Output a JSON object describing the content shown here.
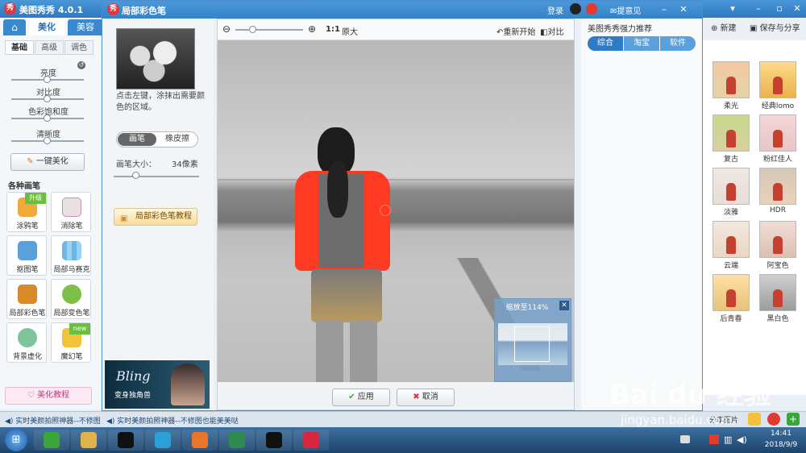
{
  "outer": {
    "title": "美图秀秀 4.0.1",
    "login": "登录",
    "feedback": "提意见",
    "new_label": "新建",
    "save_label": "保存与分享",
    "share_label": "分享图片"
  },
  "left_panel": {
    "tabs": [
      "美化",
      "美容"
    ],
    "home_icon": "home-icon",
    "sub_tabs": [
      "基础",
      "高级",
      "调色"
    ],
    "sliders": [
      {
        "label": "亮度",
        "value": 0.5
      },
      {
        "label": "对比度",
        "value": 0.5
      },
      {
        "label": "色彩饱和度",
        "value": 0.5
      },
      {
        "label": "清晰度",
        "value": 0.5
      }
    ],
    "one_click": "一键美化",
    "brush_section": "各种画笔",
    "tools": [
      {
        "label": "涂鸦笔",
        "ribbon": "升级"
      },
      {
        "label": "消除笔",
        "ribbon": ""
      },
      {
        "label": "抠图笔",
        "ribbon": ""
      },
      {
        "label": "局部马赛克",
        "ribbon": ""
      },
      {
        "label": "局部彩色笔",
        "ribbon": ""
      },
      {
        "label": "局部变色笔",
        "ribbon": ""
      },
      {
        "label": "背景虚化",
        "ribbon": ""
      },
      {
        "label": "魔幻笔",
        "ribbon": "new"
      }
    ],
    "tutorial": "美化教程"
  },
  "dialog": {
    "title": "局部彩色笔",
    "hint": "点击左键，涂抹出需要颜色的区域。",
    "mode_on": "画笔",
    "mode_off": "橡皮擦",
    "brush_size_label": "画笔大小：",
    "brush_size_value": "34像素",
    "brush_slider": 0.25,
    "tutorial_btn": "局部彩色笔教程",
    "ad_text": "Bling",
    "ad_sub": "变身独角兽",
    "zoom_slider": 0.25,
    "ratio_label": "1:1",
    "original_label": "原大",
    "restart": "重新开始",
    "compare": "对比",
    "navigator": "缩放至114%",
    "apply": "应用",
    "cancel": "取消",
    "rec_title": "美图秀秀强力推荐",
    "rec_tabs": [
      "综合",
      "淘宝",
      "软件"
    ]
  },
  "effects": [
    "柔光",
    "经典lomo",
    "复古",
    "粉红佳人",
    "淡雅",
    "HDR",
    "云端",
    "阿宝色",
    "后青春",
    "黑白色"
  ],
  "status": {
    "text1": "实时美颜拍照神器--不修图",
    "text2": "实时美颜拍照神器--不修图也能美美哒"
  },
  "taskbar": {
    "time": "14:41",
    "date": "2018/9/9",
    "apps": [
      "ie-icon",
      "folder-icon",
      "qq-icon",
      "media-icon",
      "firefox-icon",
      "app-icon",
      "record-icon",
      "meitu-icon"
    ]
  },
  "watermark": {
    "brand": "Bai du 经验",
    "url": "jingyan.baidu.com"
  }
}
